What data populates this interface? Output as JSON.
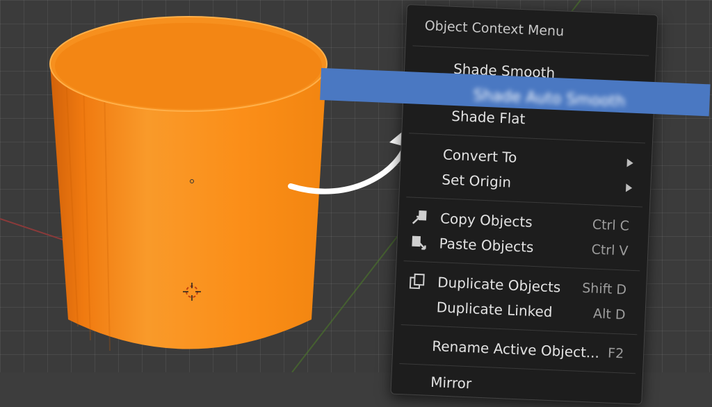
{
  "menu": {
    "title": "Object Context Menu",
    "items": [
      {
        "label": "Shade Smooth",
        "shortcut": ""
      },
      {
        "label": "Shade Auto Smooth",
        "shortcut": ""
      },
      {
        "label": "Shade Flat",
        "shortcut": ""
      },
      {
        "label": "Convert To",
        "shortcut": "",
        "submenu": true
      },
      {
        "label": "Set Origin",
        "shortcut": "",
        "submenu": true
      },
      {
        "label": "Copy Objects",
        "shortcut": "Ctrl C"
      },
      {
        "label": "Paste Objects",
        "shortcut": "Ctrl V"
      },
      {
        "label": "Duplicate Objects",
        "shortcut": "Shift D"
      },
      {
        "label": "Duplicate Linked",
        "shortcut": "Alt D"
      },
      {
        "label": "Rename Active Object...",
        "shortcut": "F2"
      },
      {
        "label": "Mirror",
        "shortcut": ""
      }
    ]
  },
  "colors": {
    "object_orange": "#f58a14",
    "menu_bg": "#1d1d1d",
    "highlight": "#4a78c2",
    "grid": "#3b3b3b"
  }
}
